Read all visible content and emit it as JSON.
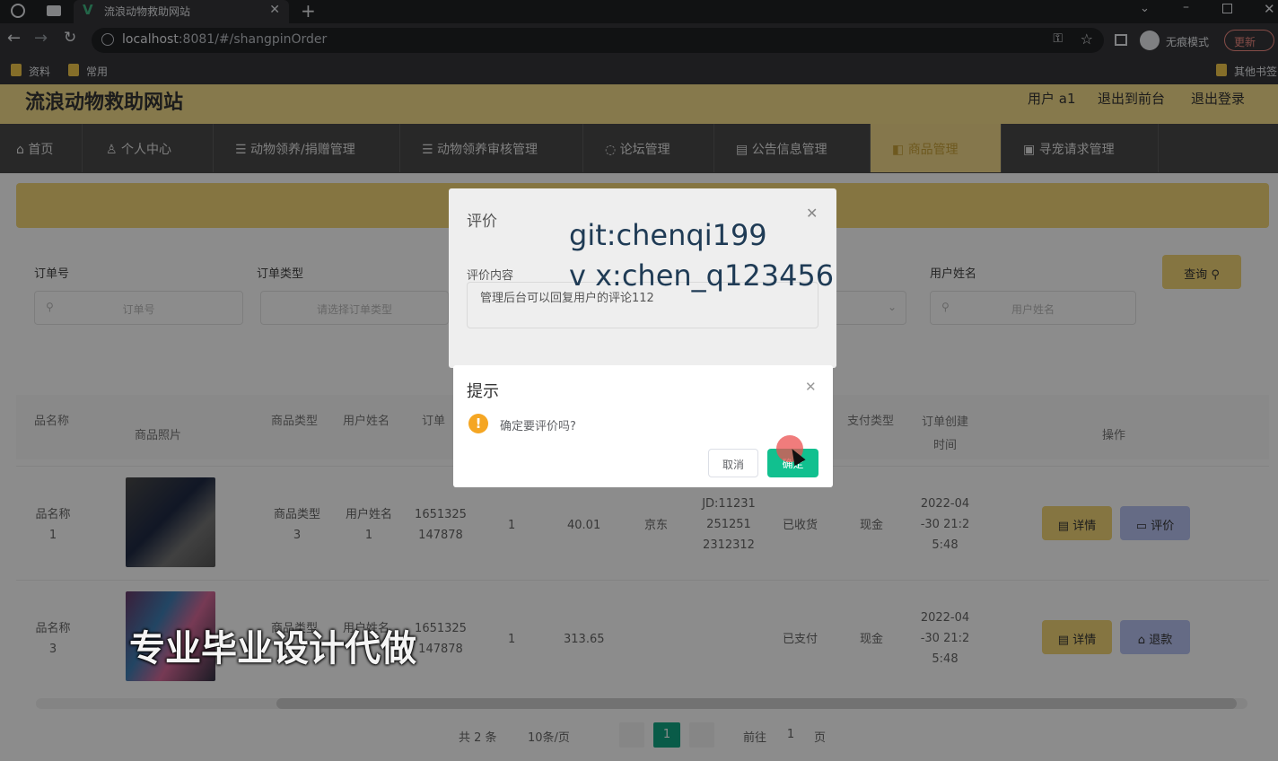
{
  "browser": {
    "tab_title": "流浪动物救助网站",
    "url_host": "localhost",
    "url_rest": ":8081/#/shangpinOrder",
    "incognito_label": "无痕模式",
    "update_label": "更新",
    "bookmarks": [
      "资料",
      "常用"
    ],
    "other_bookmarks": "其他书签"
  },
  "site": {
    "title": "流浪动物救助网站",
    "user_link": "用户 a1",
    "front_link": "退出到前台",
    "logout_link": "退出登录"
  },
  "nav": [
    "首页",
    "个人中心",
    "动物领养/捐赠管理",
    "动物领养审核管理",
    "论坛管理",
    "公告信息管理",
    "商品管理",
    "寻宠请求管理"
  ],
  "search": {
    "order_no_label": "订单号",
    "order_no_placeholder": "订单号",
    "order_type_label": "订单类型",
    "order_type_placeholder": "请选择订单类型",
    "user_name_label": "用户姓名",
    "user_name_placeholder": "用户姓名",
    "query_button": "查询"
  },
  "table": {
    "headers": [
      "品名称",
      "商品照片",
      "商品类型",
      "用户姓名",
      "订单",
      "支付类型",
      "订单创建时间",
      "操作"
    ],
    "rows": [
      {
        "name": "品名称1",
        "type": "商品类型3",
        "user": "用户姓名1",
        "order": "1651325147878",
        "qty": "1",
        "price": "40.01",
        "shop": "京东",
        "logistics": "JD:11231251251 2312312",
        "status": "已收货",
        "pay": "现金",
        "time": "2022-04-30 21:25:48",
        "btn1": "详情",
        "btn2": "评价"
      },
      {
        "name": "品名称3",
        "type": "商品类型",
        "user": "用户姓名",
        "order": "1651325147878",
        "qty": "1",
        "price": "313.65",
        "shop": "",
        "logistics": "",
        "status": "已支付",
        "pay": "现金",
        "time": "2022-04-30 21:25:48",
        "btn1": "详情",
        "btn2": "退款"
      }
    ]
  },
  "pagination": {
    "total": "共 2 条",
    "page_size": "10条/页",
    "current": "1",
    "goto_label": "前往",
    "goto_value": "1",
    "page_suffix": "页"
  },
  "eval_dialog": {
    "title": "评价",
    "content_label": "评价内容",
    "content_value": "管理后台可以回复用户的评论112"
  },
  "confirm_dialog": {
    "title": "提示",
    "message": "确定要评价吗?",
    "cancel": "取消",
    "ok": "确定"
  },
  "watermarks": {
    "line1": "git:chenqi199",
    "line2": "v x:chen_q123456",
    "banner": "专业毕业设计代做"
  },
  "colors": {
    "accent": "#f2d577",
    "nav_bg": "#4a4a4a",
    "ok_green": "#11c08f",
    "warn_orange": "#f5a623"
  }
}
